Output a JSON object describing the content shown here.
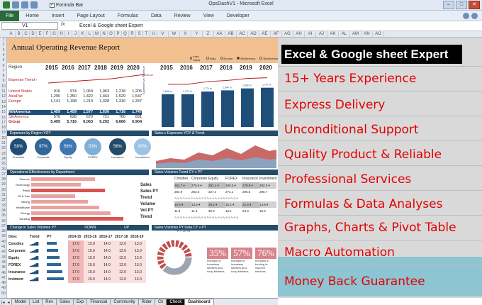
{
  "window": {
    "title": "OpsDashV1 - Microsoft Excel",
    "formula_bar_label": "Formula Bar",
    "formula_bar_check": "✓"
  },
  "ribbon": {
    "file": "File",
    "tabs": [
      "Home",
      "Insert",
      "Page Layout",
      "Formulas",
      "Data",
      "Review",
      "View",
      "Developer"
    ]
  },
  "formula": {
    "cell": "V1",
    "fx": "fx",
    "content": "Excel & Google sheet Expert"
  },
  "columns": [
    "A",
    "B",
    "C",
    "D",
    "E",
    "F",
    "G",
    "H",
    "I",
    "J",
    "K",
    "L",
    "M",
    "N",
    "O",
    "P",
    "Q",
    "R",
    "S",
    "T",
    "U",
    "V",
    "W",
    "X",
    "Y",
    "Z",
    "AA",
    "AB",
    "AC",
    "AD",
    "AE",
    "AF",
    "AG",
    "AH",
    "AI",
    "AJ",
    "AK",
    "AL",
    "AM",
    "AN",
    "AO"
  ],
  "rows": [
    "1",
    "2",
    "3",
    "4",
    "5",
    "6",
    "7",
    "8",
    "9",
    "10",
    "11",
    "12",
    "13",
    "14",
    "15",
    "16",
    "17",
    "18",
    "19",
    "20",
    "21",
    "22",
    "23",
    "24",
    "25",
    "26",
    "27",
    "28",
    "29",
    "30",
    "31",
    "32",
    "33",
    "34",
    "35",
    "36",
    "37",
    "38",
    "39",
    "40",
    "41",
    "42",
    "43",
    "44",
    "45",
    "46",
    "47",
    "48",
    "49",
    "50"
  ],
  "dashboard": {
    "title": "Annual Operating Revenue Report",
    "region_options": [
      "Inter-Sales",
      "India",
      "Europe",
      "NthAmerica",
      "SthAmerica"
    ],
    "region_selected": "NthAmerica",
    "region_label": "Region",
    "years": [
      "2015",
      "2016",
      "2017",
      "2018",
      "2019",
      "2020"
    ],
    "expense_trend_label": "Expense Trend ›",
    "revenue_flag": "Revenue",
    "table_rows": [
      {
        "name": "United States",
        "vals": [
          "916",
          "974",
          "1,064",
          "1,063",
          "1,218",
          "1,205"
        ]
      },
      {
        "name": "AsiaPac",
        "vals": [
          "1,290",
          "1,350",
          "1,422",
          "1,464",
          "1,529",
          "1,547"
        ]
      },
      {
        "name": "Europe",
        "vals": [
          "1,141",
          "1,198",
          "1,210",
          "1,328",
          "1,316",
          "1,337"
        ]
      }
    ],
    "band_row": {
      "name": "NthAmerica",
      "vals": [
        "1,459",
        "1,459",
        "1,577",
        "1,630",
        "1,716",
        "1,747"
      ]
    },
    "table_rows2": [
      {
        "name": "SthAmerica",
        "vals": [
          "576",
          "628",
          "670",
          "721",
          "760",
          "831"
        ]
      },
      {
        "name": "Group",
        "vals": [
          "5,405",
          "5,716",
          "6,063",
          "6,292",
          "6,666",
          "6,904"
        ]
      }
    ],
    "expenses_vs_revenue_label": "Expenses vs Revenue",
    "bar_chart": {
      "years": [
        "2015",
        "2016",
        "2017",
        "2018",
        "2019",
        "2020"
      ],
      "values": [
        1459,
        1459,
        1577,
        1630,
        1716,
        1747
      ],
      "labels": [
        "1,666 m",
        "1,737 m",
        "1,774 m",
        "1,844 m",
        "1,880 m",
        "1,747 m"
      ]
    },
    "sec_expenses": "Expenses by Region YOY",
    "sec_sales": "Sales v Expenses YOY & Trend",
    "circles": [
      {
        "pct": "58%",
        "label": "Crossline"
      },
      {
        "pct": "97%",
        "label": "Corporate"
      },
      {
        "pct": "56%",
        "label": "Equity"
      },
      {
        "pct": "53%",
        "label": "FOREX"
      },
      {
        "pct": "56%",
        "label": "Insurance"
      },
      {
        "pct": "90%",
        "label": "Investment"
      }
    ],
    "sec_opeff": "Operational Effectiveness by Department",
    "sec_volume": "Sales Volumes Trend CY v PY",
    "dept_labels": [
      "Telecom",
      "Technology",
      "Retail",
      "Oil & Gas",
      "Mining",
      "Healthcare",
      "Energy",
      "Banking"
    ],
    "vol_headers": [
      "Cmodies",
      "Corporate",
      "Equity",
      "FOREX",
      "Insurance",
      "Investment"
    ],
    "vol_rows": [
      {
        "label": "Sales",
        "vals": [
          "261.7 ▾",
          "275.5 ▾",
          "291.1 ▾",
          "260.3 ▾",
          "279.6 ▾",
          "292.0 ▾"
        ]
      },
      {
        "label": "Sales PY",
        "vals": [
          "284.9",
          "283.6",
          "327.4",
          "274.1",
          "296.5",
          "286.7"
        ]
      },
      {
        "label": "Trend",
        "vals": [
          "",
          "",
          "",
          "",
          "",
          ""
        ]
      },
      {
        "label": "Volume",
        "vals": [
          "10.5 ▾",
          "13.5 ▾",
          "30.1 ▾",
          "15.1 ▾",
          "22.5 ▾",
          "14.8 ▾"
        ]
      },
      {
        "label": "Vol PY",
        "vals": [
          "11.8",
          "11.3",
          "30.3",
          "16.1",
          "24.0",
          "16.6"
        ]
      },
      {
        "label": "Trend",
        "vals": [
          "",
          "",
          "",
          "",
          "",
          ""
        ]
      }
    ],
    "sec_change": "Change in Sales Volumes PY",
    "down_label": "DOWN",
    "up_label": "UP",
    "sec_pydata": "Sales Volumes PY Data CY v PY",
    "bottom_table": {
      "headers": [
        "Desc",
        "Trend",
        "PY",
        "2014-15",
        "2015-16",
        "2016-17",
        "2017-18",
        "2018-19"
      ],
      "rows": [
        {
          "name": "Cmodies",
          "vals": [
            "17.0",
            "15.0",
            "14.0",
            "12.0",
            "13.0"
          ]
        },
        {
          "name": "Corporate",
          "vals": [
            "17.0",
            "15.0",
            "14.0",
            "12.0",
            "13.0"
          ]
        },
        {
          "name": "Equity",
          "vals": [
            "17.0",
            "15.0",
            "14.0",
            "12.0",
            "13.0"
          ]
        },
        {
          "name": "FOREX",
          "vals": [
            "17.0",
            "15.0",
            "14.0",
            "12.0",
            "13.0"
          ]
        },
        {
          "name": "Insurance",
          "vals": [
            "17.0",
            "15.0",
            "14.0",
            "12.0",
            "13.0"
          ]
        },
        {
          "name": "Invtment",
          "vals": [
            "17.0",
            "15.0",
            "14.0",
            "12.0",
            "13.0"
          ]
        }
      ]
    },
    "donut_label": "PY 37%",
    "pct_boxes": [
      {
        "pct": "35%",
        "text": "Increase in homeless shelters and soup kitchens."
      },
      {
        "pct": "57%",
        "text": "Increase in homeless shelters and soup kitchens."
      },
      {
        "pct": "76%",
        "text": "Increase in funding to improve services."
      }
    ]
  },
  "sheet_tabs": [
    "Model",
    "List",
    "Rev",
    "Sales",
    "Exp",
    "Financial",
    "Community",
    "Rider",
    "Ck",
    "Check",
    "Dashboard"
  ],
  "active_tab": "Dashboard",
  "right_panel": {
    "header": "Excel & Google sheet Expert",
    "items": [
      "15+ Years Experience",
      "Express Delivery",
      "Unconditional Support",
      "Quality Product & Reliable",
      "Professional Services",
      "Formulas & Data Analyses",
      "Graphs, Charts & Pivot Table",
      "Macro Automation",
      "Money Back Guarantee"
    ]
  },
  "colors": {
    "brand_green": "#2a6a3c",
    "accent_red": "#e30000",
    "header_orange": "#f2c08f",
    "navy": "#1f4e79",
    "band_cyan": "#8ec5d2"
  }
}
